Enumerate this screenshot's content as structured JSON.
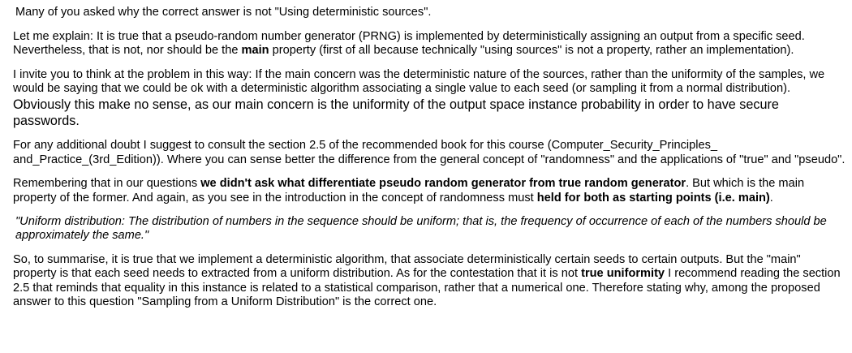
{
  "paragraphs": {
    "p1": {
      "text": "Many of you asked why the correct answer is not \"Using deterministic sources\"."
    },
    "p2": {
      "a": "Let me explain: It is true that a pseudo-random number generator (PRNG) is implemented by deterministically assigning an output from a specific seed. Nevertheless, that is not, nor should be the ",
      "b": "main",
      "c": " property (first of all because technically \"using sources\" is not a property, rather an implementation)."
    },
    "p3": {
      "a": "I invite you to think at the problem in this way: If the main concern was the deterministic nature of the sources, rather than the uniformity of the samples, we would be saying that we could be ok with a deterministic algorithm associating a single value to each seed (or sampling it from a normal distribution). ",
      "b": "Obviously this make no sense, as our main concern is the uniformity of the output space instance probability in order to have secure passwords."
    },
    "p4": {
      "a": "For any additional doubt I suggest to consult the section 2.5 of the recommended book for this course (Computer_Security_Principles_",
      "b": "and_Practice_(3rd_Edition)). Where you can sense better the difference from the general concept of \"randomness\" and the applications of \"true\" and \"pseudo\"."
    },
    "p5": {
      "a": "Remembering that in our questions ",
      "b": "we didn't ask what differentiate pseudo random generator from true random generator",
      "c": ". But which is the main property of the former. And again, as you see in the introduction in the concept of randomness must ",
      "d": "held for both as starting points (i.e. main)",
      "e": "."
    },
    "p6": {
      "text": "\"Uniform distribution: The distribution of numbers in the sequence should be uniform; that is, the frequency of occurrence of each of the numbers should be approximately the same.\""
    },
    "p7": {
      "a": "So, to summarise, it is true that we implement a deterministic algorithm, that associate deterministically certain seeds to certain outputs. But the \"main\" property is that each seed needs to extracted from a uniform distribution. As for the contestation that it is not ",
      "b": "true uniformity",
      "c": " I recommend reading the section 2.5 that reminds that equality in this instance is related to a statistical comparison, rather that a numerical one. Therefore stating why, among the proposed answer to this question \"Sampling from a Uniform Distribution\" is the correct one."
    }
  }
}
